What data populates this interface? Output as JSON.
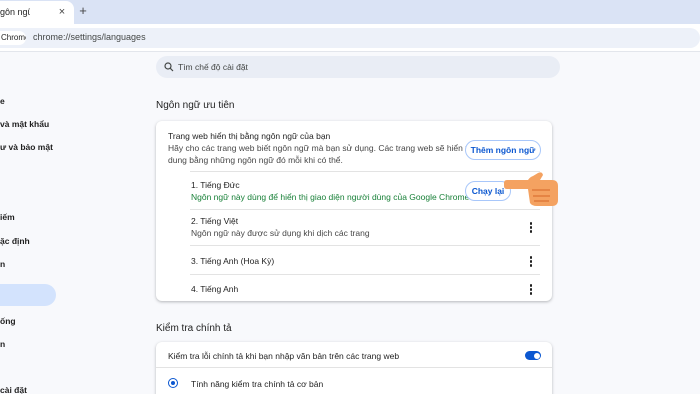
{
  "tab": {
    "title": "gôn ngữ",
    "close_glyph": "×",
    "new_tab_glyph": "+"
  },
  "omnibox": {
    "chip": "Chrome",
    "url": "chrome://settings/languages"
  },
  "sidebar": {
    "items": [
      {
        "label": "e"
      },
      {
        "label": "và mật khẩu"
      },
      {
        "label": "ư và bảo mật"
      },
      {
        "label": "iếm"
      },
      {
        "label": "ặc định"
      },
      {
        "label": "n"
      },
      {
        "label": "ống"
      },
      {
        "label": "n"
      },
      {
        "label": "cài đặt"
      }
    ]
  },
  "search": {
    "placeholder": "Tìm chế độ cài đặt"
  },
  "preferred": {
    "heading": "Ngôn ngữ ưu tiên",
    "intro_title": "Trang web hiển thị bằng ngôn ngữ của bạn",
    "intro_line1": "Hãy cho các trang web biết ngôn ngữ mà bạn sử dụng. Các trang web sẽ hiển thị nội",
    "intro_line2": "dung bằng những ngôn ngữ đó mỗi khi có thể.",
    "add_button": "Thêm ngôn ngữ",
    "languages": [
      {
        "name": "1. Tiếng Đức",
        "note": "Ngôn ngữ này dùng để hiển thị giao diện người dùng của Google Chrome"
      },
      {
        "name": "2. Tiếng Việt",
        "note": "Ngôn ngữ này được sử dụng khi dịch các trang"
      },
      {
        "name": "3. Tiếng Anh (Hoa Kỳ)"
      },
      {
        "name": "4. Tiếng Anh"
      }
    ],
    "relaunch_button": "Chạy lại"
  },
  "spellcheck": {
    "heading": "Kiểm tra chính tả",
    "toggle_label": "Kiểm tra lỗi chính tả khi bạn nhập văn bản trên các trang web",
    "toggle_on": true,
    "option_basic": "Tính năng kiểm tra chính tả cơ bản"
  },
  "colors": {
    "accent": "#0b57d0",
    "note_green": "#188038",
    "highlight": "#d3e3fd",
    "hand": "#f4a261"
  }
}
